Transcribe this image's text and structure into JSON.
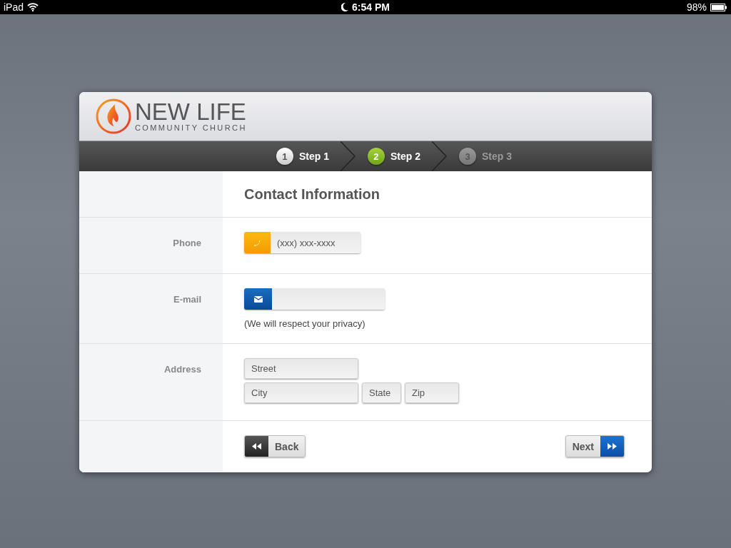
{
  "status_bar": {
    "device": "iPad",
    "time": "6:54 PM",
    "battery": "98%"
  },
  "logo": {
    "title": "NEW LIFE",
    "subtitle": "COMMUNITY CHURCH"
  },
  "steps": [
    {
      "number": "1",
      "label": "Step 1",
      "completed": true,
      "selected": false
    },
    {
      "number": "2",
      "label": "Step 2",
      "completed": false,
      "selected": true
    },
    {
      "number": "3",
      "label": "Step 3",
      "completed": false,
      "selected": false
    }
  ],
  "form": {
    "title": "Contact Information",
    "phone": {
      "label": "Phone",
      "placeholder": "(xxx) xxx-xxxx"
    },
    "email": {
      "label": "E-mail",
      "note": "(We will respect your privacy)"
    },
    "address": {
      "label": "Address",
      "street": {
        "placeholder": "Street"
      },
      "city": {
        "placeholder": "City"
      },
      "state": {
        "placeholder": "State"
      },
      "zip": {
        "placeholder": "Zip"
      }
    }
  },
  "buttons": {
    "back": "Back",
    "next": "Next"
  }
}
